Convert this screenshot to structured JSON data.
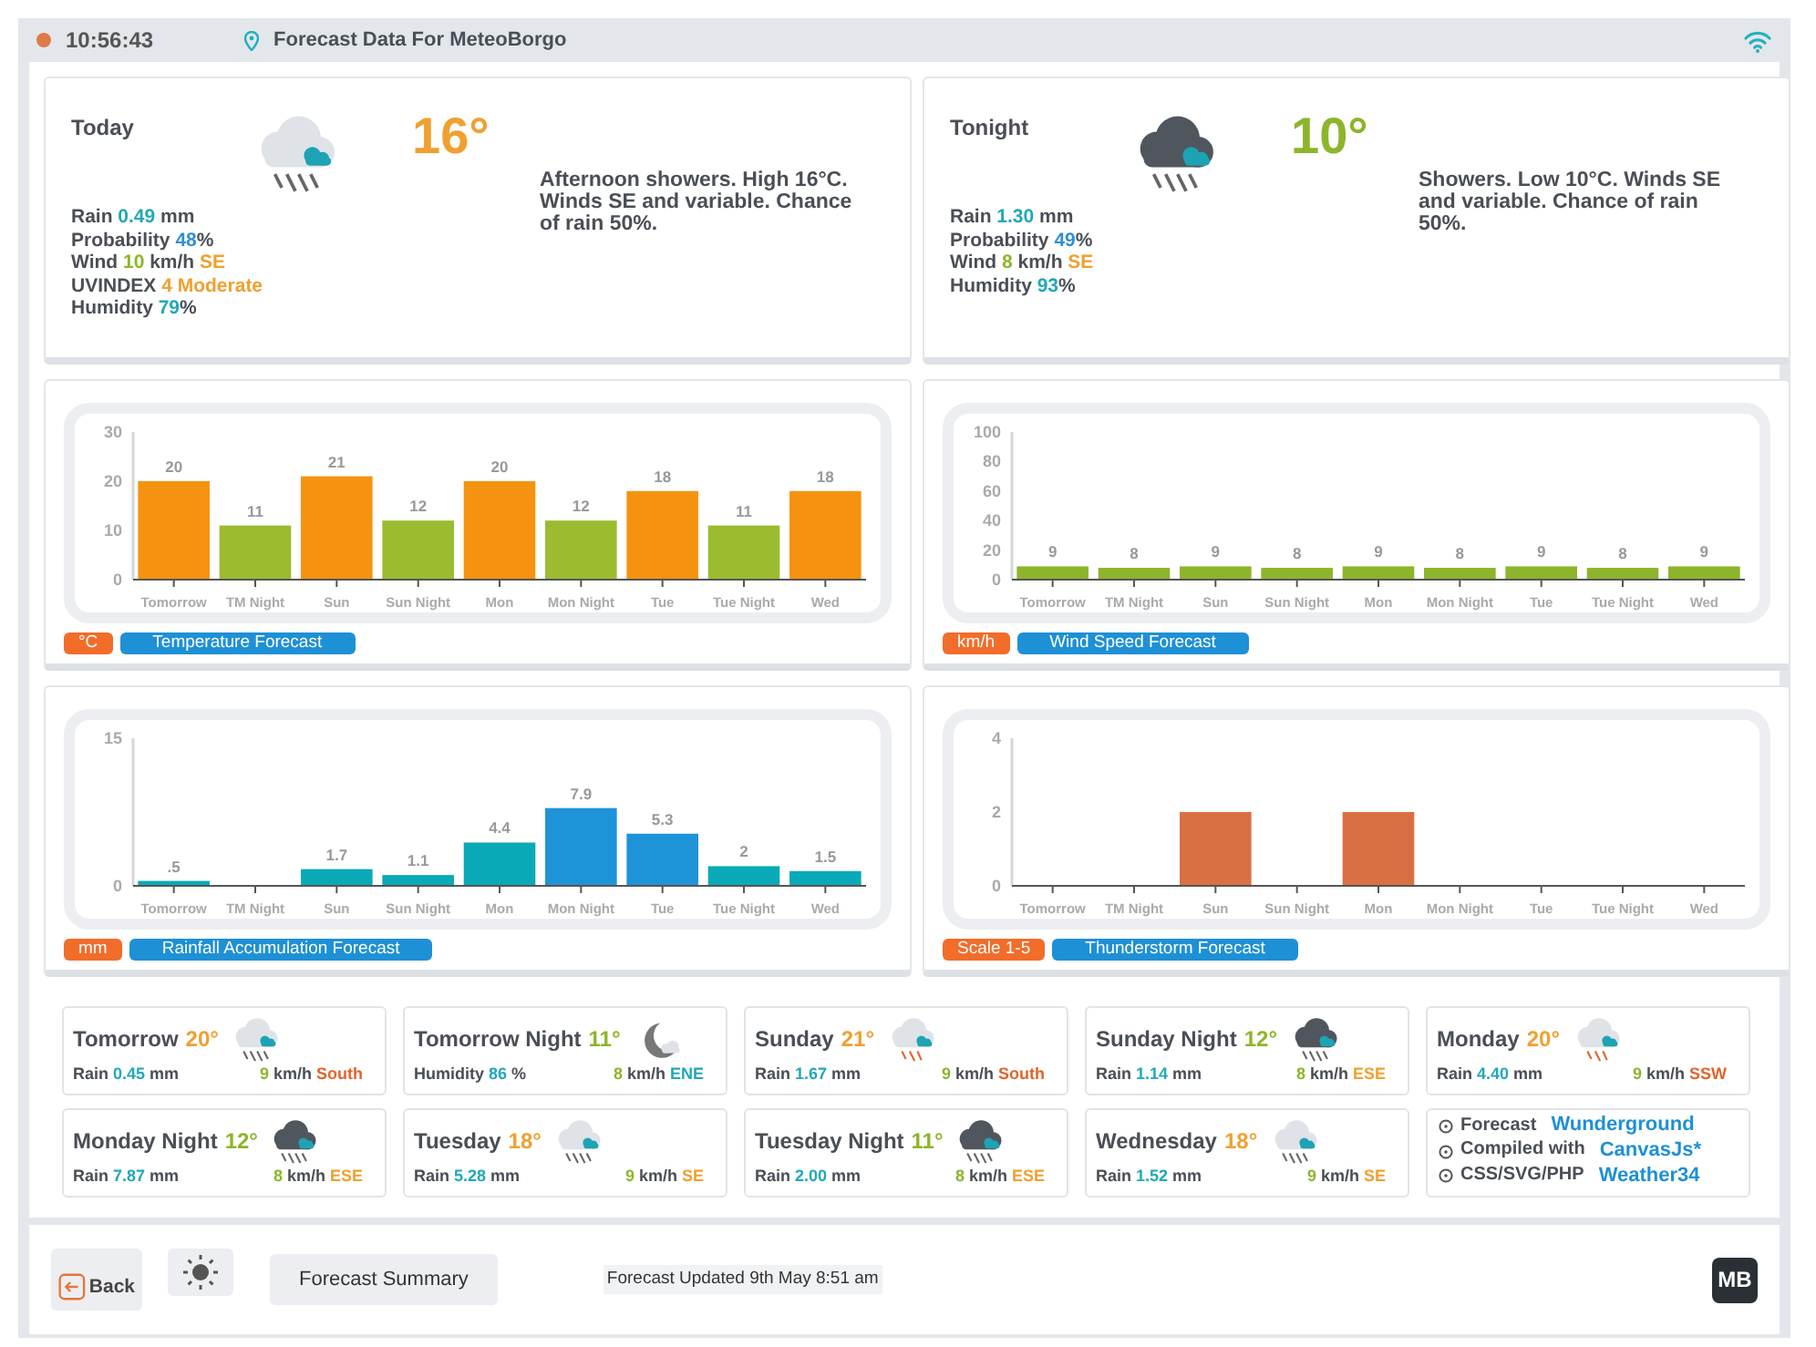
{
  "header": {
    "time": "10:56:43",
    "title": "Forecast Data For MeteoBorgo"
  },
  "current": [
    {
      "period": "Today",
      "kind": "day",
      "temperature": {
        "text": "16°",
        "color": "#f0a030"
      },
      "stats": [
        {
          "kind": "rain",
          "label": "Rain",
          "value": "0.49",
          "unit": "mm"
        },
        {
          "kind": "probability",
          "label": "Probability",
          "value": "48",
          "unit": "%"
        },
        {
          "kind": "wind",
          "label": "Wind",
          "value": "10",
          "unit": "km/h",
          "direction": "SE"
        },
        {
          "kind": "uv",
          "label": "UVINDEX",
          "value": "4 Moderate"
        },
        {
          "kind": "humidity",
          "label": "Humidity",
          "value": "79",
          "unit": "%"
        }
      ],
      "description": "Afternoon showers. High 16°C. Winds SE and variable. Chance of rain 50%."
    },
    {
      "period": "Tonight",
      "kind": "night",
      "temperature": {
        "text": "10°",
        "color": "#8db52b"
      },
      "stats": [
        {
          "kind": "rain",
          "label": "Rain",
          "value": "1.30",
          "unit": "mm"
        },
        {
          "kind": "probability",
          "label": "Probability",
          "value": "49",
          "unit": "%"
        },
        {
          "kind": "wind",
          "label": "Wind",
          "value": "8",
          "unit": "km/h",
          "direction": "SE"
        },
        {
          "kind": "humidity",
          "label": "Humidity",
          "value": "93",
          "unit": "%"
        }
      ],
      "description": "Showers. Low 10°C. Winds SE and variable. Chance of rain 50%."
    }
  ],
  "charts": [
    {
      "unit": "°C",
      "title": "Temperature Forecast",
      "chart_data": {
        "type": "bar",
        "categories": [
          "Tomorrow",
          "TM Night",
          "Sun",
          "Sun Night",
          "Mon",
          "Mon Night",
          "Tue",
          "Tue Night",
          "Wed"
        ],
        "ylim": [
          0,
          30
        ],
        "yticks": [
          0,
          10,
          20,
          30
        ],
        "value_labels": [
          "20",
          "11",
          "21",
          "12",
          "20",
          "12",
          "18",
          "11",
          "18"
        ],
        "series": [
          {
            "color": "#f59310",
            "values": [
              20,
              null,
              21,
              null,
              20,
              null,
              18,
              null,
              18
            ]
          },
          {
            "color": "#9bbb30",
            "values": [
              null,
              11,
              null,
              12,
              null,
              12,
              null,
              11,
              null
            ]
          }
        ]
      }
    },
    {
      "unit": "km/h",
      "title": "Wind Speed Forecast",
      "chart_data": {
        "type": "bar",
        "categories": [
          "Tomorrow",
          "TM Night",
          "Sun",
          "Sun Night",
          "Mon",
          "Mon Night",
          "Tue",
          "Tue Night",
          "Wed"
        ],
        "ylim": [
          0,
          100
        ],
        "yticks": [
          0,
          20,
          40,
          60,
          80,
          100
        ],
        "value_labels": [
          "9",
          "8",
          "9",
          "8",
          "9",
          "8",
          "9",
          "8",
          "9"
        ],
        "series": [
          {
            "color": "#8db52b",
            "values": [
              9,
              8,
              9,
              8,
              9,
              8,
              9,
              8,
              9
            ]
          }
        ]
      }
    },
    {
      "unit": "mm",
      "title": "Rainfall Accumulation Forecast",
      "chart_data": {
        "type": "bar",
        "categories": [
          "Tomorrow",
          "TM Night",
          "Sun",
          "Sun Night",
          "Mon",
          "Mon Night",
          "Tue",
          "Tue Night",
          "Wed"
        ],
        "ylim": [
          0,
          15
        ],
        "yticks": [
          0,
          15
        ],
        "value_labels": [
          ".5",
          null,
          "1.7",
          "1.1",
          "4.4",
          "7.9",
          "5.3",
          "2",
          "1.5"
        ],
        "series": [
          {
            "color": "#0aa9b8",
            "values": [
              0.5,
              0,
              1.7,
              1.1,
              4.4,
              null,
              null,
              2,
              1.5
            ]
          },
          {
            "color": "#1e93d8",
            "values": [
              null,
              null,
              null,
              null,
              null,
              7.9,
              5.3,
              null,
              null
            ]
          }
        ]
      }
    },
    {
      "unit": "Scale 1-5",
      "title": "Thunderstorm Forecast",
      "chart_data": {
        "type": "bar",
        "categories": [
          "Tomorrow",
          "TM Night",
          "Sun",
          "Sun Night",
          "Mon",
          "Mon Night",
          "Tue",
          "Tue Night",
          "Wed"
        ],
        "ylim": [
          0,
          4
        ],
        "yticks": [
          0,
          2,
          4
        ],
        "series": [
          {
            "color": "#d97043",
            "values": [
              0,
              0,
              2,
              0,
              2,
              0,
              0,
              0,
              0
            ]
          }
        ]
      }
    }
  ],
  "outlook": [
    {
      "name": "Tomorrow",
      "kind": "rain",
      "temperature": {
        "text": "20°",
        "color": "#f0a030"
      },
      "detail": {
        "label": "Rain",
        "value": "0.45",
        "unit": "mm"
      },
      "wind": "9",
      "wind_unit": "km/h",
      "direction": {
        "text": "South",
        "color": "#e0652e"
      }
    },
    {
      "name": "Tomorrow Night",
      "kind": "moon",
      "temperature": {
        "text": "11°",
        "color": "#8db52b"
      },
      "detail": {
        "label": "Humidity",
        "value": "86",
        "unit": "%"
      },
      "wind": "8",
      "wind_unit": "km/h",
      "direction": {
        "text": "ENE",
        "color": "#21a8b8"
      }
    },
    {
      "name": "Sunday",
      "kind": "thunder",
      "temperature": {
        "text": "21°",
        "color": "#f0a030"
      },
      "detail": {
        "label": "Rain",
        "value": "1.67",
        "unit": "mm"
      },
      "wind": "9",
      "wind_unit": "km/h",
      "direction": {
        "text": "South",
        "color": "#e0652e"
      }
    },
    {
      "name": "Sunday Night",
      "kind": "storm",
      "temperature": {
        "text": "12°",
        "color": "#8db52b"
      },
      "detail": {
        "label": "Rain",
        "value": "1.14",
        "unit": "mm"
      },
      "wind": "8",
      "wind_unit": "km/h",
      "direction": {
        "text": "ESE",
        "color": "#f0a030"
      }
    },
    {
      "name": "Monday",
      "kind": "thunder",
      "temperature": {
        "text": "20°",
        "color": "#f0a030"
      },
      "detail": {
        "label": "Rain",
        "value": "4.40",
        "unit": "mm"
      },
      "wind": "9",
      "wind_unit": "km/h",
      "direction": {
        "text": "SSW",
        "color": "#e0652e"
      }
    },
    {
      "name": "Monday Night",
      "kind": "storm",
      "temperature": {
        "text": "12°",
        "color": "#8db52b"
      },
      "detail": {
        "label": "Rain",
        "value": "7.87",
        "unit": "mm"
      },
      "wind": "8",
      "wind_unit": "km/h",
      "direction": {
        "text": "ESE",
        "color": "#f0a030"
      }
    },
    {
      "name": "Tuesday",
      "kind": "rain",
      "temperature": {
        "text": "18°",
        "color": "#f0a030"
      },
      "detail": {
        "label": "Rain",
        "value": "5.28",
        "unit": "mm"
      },
      "wind": "9",
      "wind_unit": "km/h",
      "direction": {
        "text": "SE",
        "color": "#f0a030"
      }
    },
    {
      "name": "Tuesday Night",
      "kind": "storm",
      "temperature": {
        "text": "11°",
        "color": "#8db52b"
      },
      "detail": {
        "label": "Rain",
        "value": "2.00",
        "unit": "mm"
      },
      "wind": "8",
      "wind_unit": "km/h",
      "direction": {
        "text": "ESE",
        "color": "#f0a030"
      }
    },
    {
      "name": "Wednesday",
      "kind": "rain",
      "temperature": {
        "text": "18°",
        "color": "#f0a030"
      },
      "detail": {
        "label": "Rain",
        "value": "1.52",
        "unit": "mm"
      },
      "wind": "9",
      "wind_unit": "km/h",
      "direction": {
        "text": "SE",
        "color": "#f0a030"
      }
    }
  ],
  "credits": [
    {
      "label": "Forecast",
      "link": "Wunderground"
    },
    {
      "label": "Compiled with",
      "link": "CanvasJs*"
    },
    {
      "label": "CSS/SVG/PHP",
      "link": "Weather34"
    }
  ],
  "footer": {
    "back": "Back",
    "summary_button": "Forecast Summary",
    "updated": "Forecast Updated 9th May 8:51 am",
    "logo": "MB"
  }
}
